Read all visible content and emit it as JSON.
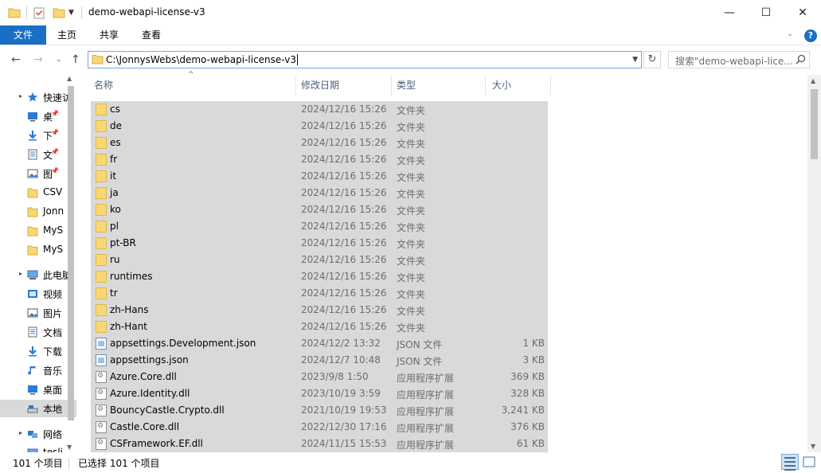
{
  "window": {
    "title": "demo-webapi-license-v3",
    "minimize_glyph": "—",
    "maximize_glyph": "☐",
    "close_glyph": "✕"
  },
  "ribbon": {
    "tabs": [
      "文件",
      "主页",
      "共享",
      "查看"
    ],
    "help_glyph": "?",
    "accent": "#1a6fc4"
  },
  "nav": {
    "address": "C:\\JonnysWebs\\demo-webapi-license-v3",
    "search_placeholder": "搜索\"demo-webapi-lice...",
    "refresh_glyph": "↻"
  },
  "sidebar": {
    "items": [
      {
        "label": "快速访",
        "icon": "star-icon",
        "pin": false
      },
      {
        "label": "桌",
        "icon": "desktop-icon",
        "pin": true
      },
      {
        "label": "下",
        "icon": "download-icon",
        "pin": true
      },
      {
        "label": "文",
        "icon": "document-icon",
        "pin": true
      },
      {
        "label": "图",
        "icon": "picture-icon",
        "pin": true
      },
      {
        "label": "CSV",
        "icon": "folder-icon",
        "pin": false
      },
      {
        "label": "Jonn",
        "icon": "folder-icon",
        "pin": false
      },
      {
        "label": "MyS",
        "icon": "folder-icon",
        "pin": false
      },
      {
        "label": "MyS",
        "icon": "folder-icon",
        "pin": false
      },
      {
        "label": "此电脑",
        "icon": "computer-icon",
        "pin": false
      },
      {
        "label": "视频",
        "icon": "video-icon",
        "pin": false
      },
      {
        "label": "图片",
        "icon": "picture-icon",
        "pin": false
      },
      {
        "label": "文档",
        "icon": "document-icon",
        "pin": false
      },
      {
        "label": "下载",
        "icon": "download-icon",
        "pin": false
      },
      {
        "label": "音乐",
        "icon": "music-icon",
        "pin": false
      },
      {
        "label": "桌面",
        "icon": "desktop-icon",
        "pin": false
      },
      {
        "label": "本地",
        "icon": "drive-icon",
        "pin": false
      },
      {
        "label": "网络",
        "icon": "network-icon",
        "pin": false
      },
      {
        "label": "tesli",
        "icon": "computer-icon",
        "pin": false
      }
    ]
  },
  "columns": {
    "name": "名称",
    "date": "修改日期",
    "type": "类型",
    "size": "大小"
  },
  "files": [
    {
      "name": "cs",
      "date": "2024/12/16 15:26",
      "type": "文件夹",
      "size": "",
      "kind": "folder"
    },
    {
      "name": "de",
      "date": "2024/12/16 15:26",
      "type": "文件夹",
      "size": "",
      "kind": "folder"
    },
    {
      "name": "es",
      "date": "2024/12/16 15:26",
      "type": "文件夹",
      "size": "",
      "kind": "folder"
    },
    {
      "name": "fr",
      "date": "2024/12/16 15:26",
      "type": "文件夹",
      "size": "",
      "kind": "folder"
    },
    {
      "name": "it",
      "date": "2024/12/16 15:26",
      "type": "文件夹",
      "size": "",
      "kind": "folder"
    },
    {
      "name": "ja",
      "date": "2024/12/16 15:26",
      "type": "文件夹",
      "size": "",
      "kind": "folder"
    },
    {
      "name": "ko",
      "date": "2024/12/16 15:26",
      "type": "文件夹",
      "size": "",
      "kind": "folder"
    },
    {
      "name": "pl",
      "date": "2024/12/16 15:26",
      "type": "文件夹",
      "size": "",
      "kind": "folder"
    },
    {
      "name": "pt-BR",
      "date": "2024/12/16 15:26",
      "type": "文件夹",
      "size": "",
      "kind": "folder"
    },
    {
      "name": "ru",
      "date": "2024/12/16 15:26",
      "type": "文件夹",
      "size": "",
      "kind": "folder"
    },
    {
      "name": "runtimes",
      "date": "2024/12/16 15:26",
      "type": "文件夹",
      "size": "",
      "kind": "folder"
    },
    {
      "name": "tr",
      "date": "2024/12/16 15:26",
      "type": "文件夹",
      "size": "",
      "kind": "folder"
    },
    {
      "name": "zh-Hans",
      "date": "2024/12/16 15:26",
      "type": "文件夹",
      "size": "",
      "kind": "folder"
    },
    {
      "name": "zh-Hant",
      "date": "2024/12/16 15:26",
      "type": "文件夹",
      "size": "",
      "kind": "folder"
    },
    {
      "name": "appsettings.Development.json",
      "date": "2024/12/2 13:32",
      "type": "JSON 文件",
      "size": "1 KB",
      "kind": "json"
    },
    {
      "name": "appsettings.json",
      "date": "2024/12/7 10:48",
      "type": "JSON 文件",
      "size": "3 KB",
      "kind": "json"
    },
    {
      "name": "Azure.Core.dll",
      "date": "2023/9/8 1:50",
      "type": "应用程序扩展",
      "size": "369 KB",
      "kind": "dll"
    },
    {
      "name": "Azure.Identity.dll",
      "date": "2023/10/19 3:59",
      "type": "应用程序扩展",
      "size": "328 KB",
      "kind": "dll"
    },
    {
      "name": "BouncyCastle.Crypto.dll",
      "date": "2021/10/19 19:53",
      "type": "应用程序扩展",
      "size": "3,241 KB",
      "kind": "dll"
    },
    {
      "name": "Castle.Core.dll",
      "date": "2022/12/30 17:16",
      "type": "应用程序扩展",
      "size": "376 KB",
      "kind": "dll"
    },
    {
      "name": "CSFramework.EF.dll",
      "date": "2024/11/15 15:53",
      "type": "应用程序扩展",
      "size": "61 KB",
      "kind": "dll"
    }
  ],
  "status": {
    "count": "101 个项目",
    "selected": "已选择 101 个项目"
  },
  "colors": {
    "selection_bg": "#d9d9d9",
    "folder_yellow": "#f8d775"
  }
}
